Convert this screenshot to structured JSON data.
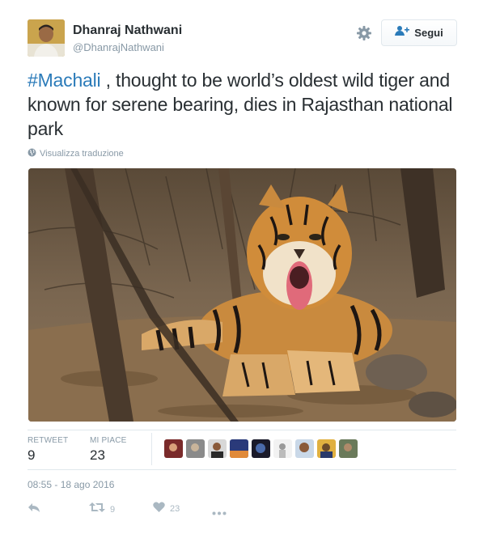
{
  "user": {
    "name": "Dhanraj Nathwani",
    "handle": "@DhanrajNathwani"
  },
  "follow_button": {
    "label": "Segui"
  },
  "tweet": {
    "hashtag": "#Machali",
    "text": " , thought to be world’s oldest wild tiger and known for serene bearing, dies in Rajasthan national park",
    "translate_label": "Visualizza traduzione"
  },
  "stats": {
    "retweets_label": "RETWEET",
    "retweets_value": "9",
    "likes_label": "MI PIACE",
    "likes_value": "23"
  },
  "timestamp": "08:55 - 18 ago 2016",
  "actions": {
    "retweet_count": "9",
    "like_count": "23"
  },
  "colors": {
    "link": "#2b7bb9",
    "muted": "#8899a6",
    "text": "#292f33",
    "border": "#e1e8ed"
  },
  "icons": [
    "settings-gear-icon",
    "follow-person-icon",
    "globe-icon",
    "reply-icon",
    "retweet-icon",
    "heart-icon",
    "more-icon"
  ]
}
